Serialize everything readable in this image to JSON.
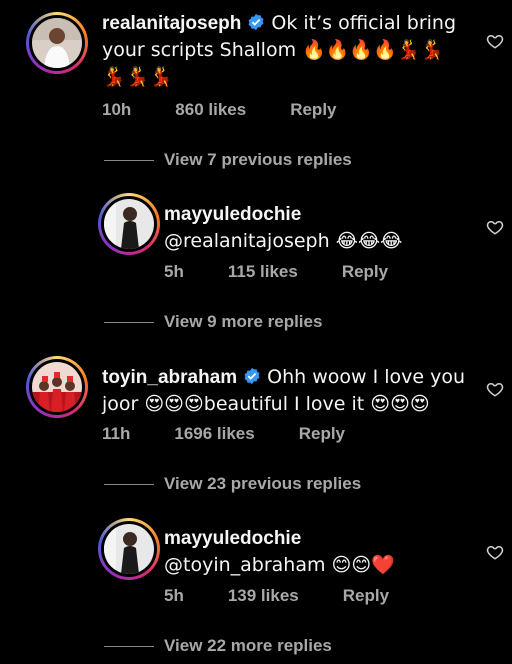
{
  "comments": [
    {
      "username": "realanitajoseph",
      "verified": true,
      "text_line1": "Ok it’s official bring",
      "text_line2": "your scripts Shallom 🔥🔥🔥🔥💃💃",
      "text_line3": "💃💃💃",
      "time": "10h",
      "likes": "860 likes",
      "reply": "Reply",
      "view_replies": "View 7 previous replies"
    },
    {
      "username": "mayyuledochie",
      "verified": false,
      "text_line1": "@realanitajoseph 😂😂😂",
      "time": "5h",
      "likes": "115 likes",
      "reply": "Reply",
      "view_replies": "View 9 more replies"
    },
    {
      "username": "toyin_abraham",
      "verified": true,
      "text_line1": "Ohh woow  I love you",
      "text_line2": "joor 😍😍😍beautiful I love it 😍😍😍",
      "time": "11h",
      "likes": "1696 likes",
      "reply": "Reply",
      "view_replies": "View 23 previous replies"
    },
    {
      "username": "mayyuledochie",
      "verified": false,
      "text_line1": "@toyin_abraham 😊😊❤️",
      "time": "5h",
      "likes": "139 likes",
      "reply": "Reply",
      "view_replies": "View 22 more replies"
    }
  ],
  "colors": {
    "verified": "#3897f0",
    "meta": "#a8a8a8",
    "background": "#000000"
  }
}
